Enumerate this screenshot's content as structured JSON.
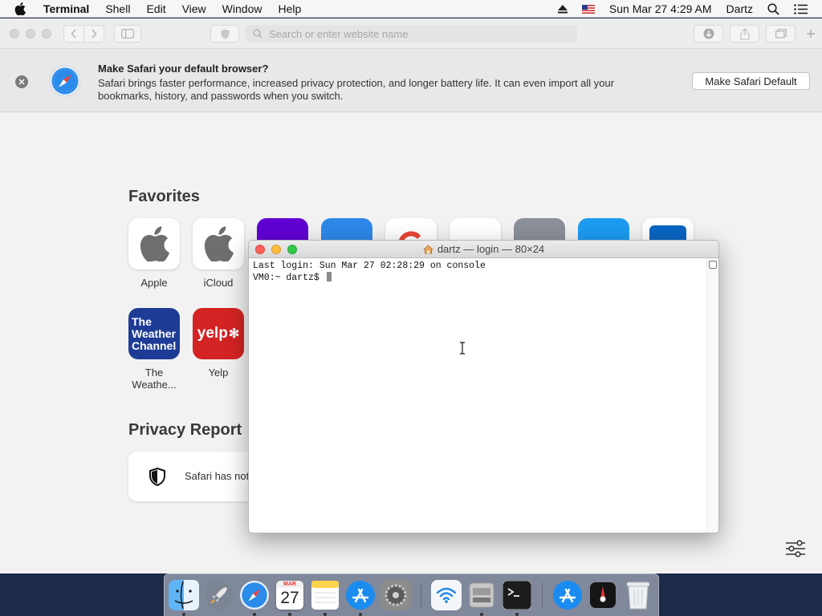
{
  "menubar": {
    "app_name": "Terminal",
    "menus": [
      "Shell",
      "Edit",
      "View",
      "Window",
      "Help"
    ],
    "datetime": "Sun Mar 27  4:29 AM",
    "user": "Dartz"
  },
  "safari": {
    "address_placeholder": "Search or enter website name",
    "banner": {
      "title": "Make Safari your default browser?",
      "description": "Safari brings faster performance, increased privacy protection, and longer battery life. It can even import all your bookmarks, history, and passwords when you switch.",
      "button": "Make Safari Default"
    },
    "favorites_heading": "Favorites",
    "favorites": [
      {
        "label": "Apple"
      },
      {
        "label": "iCloud"
      },
      {
        "label": "The Weathe..."
      },
      {
        "label": "Yelp"
      }
    ],
    "weather_tile_text": [
      "The",
      "Weather",
      "Channel"
    ],
    "yelp_tile_text": "yelp",
    "privacy_heading": "Privacy Report",
    "privacy_text": "Safari has not"
  },
  "terminal": {
    "title": "dartz — login — 80×24",
    "lines": [
      "Last login: Sun Mar 27 02:28:29 on console",
      "VM0:~ dartz$ "
    ]
  },
  "dock": {
    "calendar_month": "MAR",
    "calendar_day": "27"
  },
  "colors": {
    "close": "#fc605b",
    "minimize": "#fdbc40",
    "zoom": "#34c84a",
    "weather": "#1e3c96",
    "yelp": "#d32323"
  }
}
